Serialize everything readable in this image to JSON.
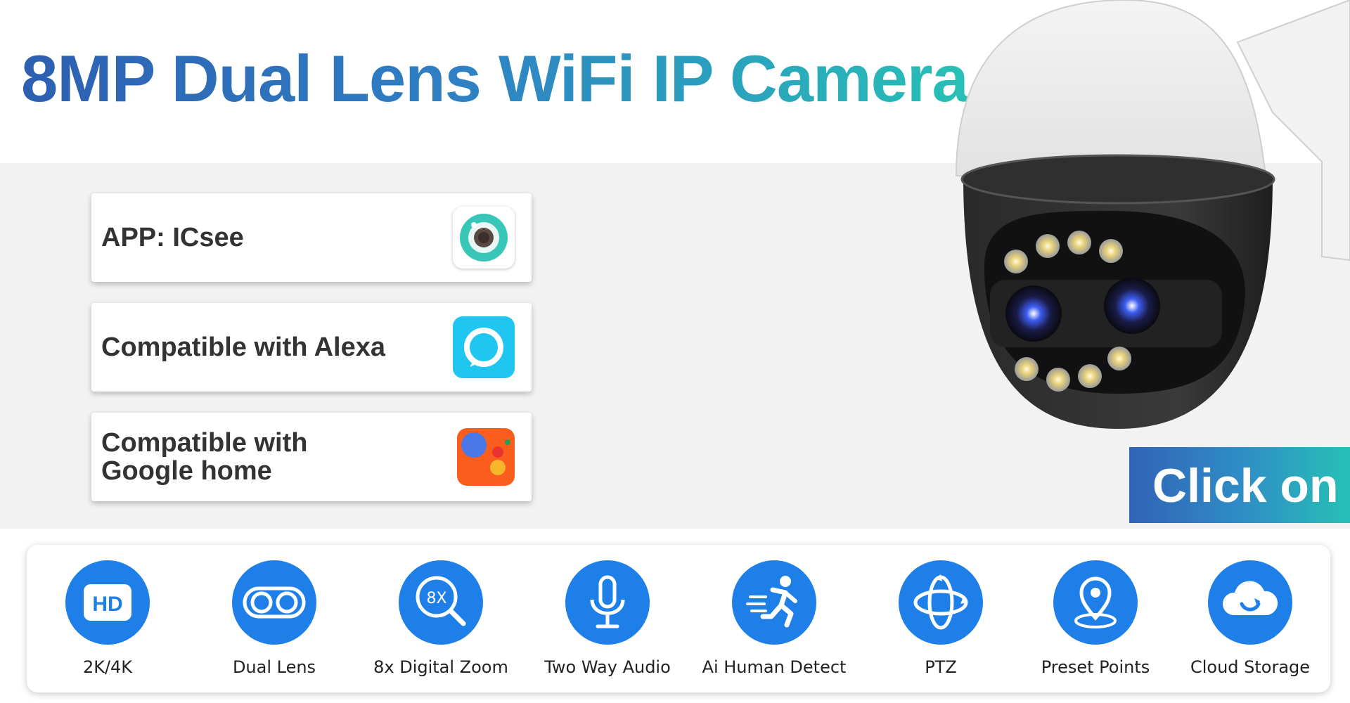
{
  "headline": "8MP Dual Lens WiFi IP Camera",
  "cards": [
    {
      "label": "APP: ICsee",
      "icon": "icsee-app-icon"
    },
    {
      "label": "Compatible with Alexa",
      "icon": "alexa-icon"
    },
    {
      "label": "Compatible with\nGoogle home",
      "icon": "google-home-icon"
    }
  ],
  "cta": {
    "label": "Click on"
  },
  "features": [
    {
      "label": "2K/4K",
      "icon": "hd-icon"
    },
    {
      "label": "Dual Lens",
      "icon": "dual-lens-icon"
    },
    {
      "label": "8x Digital Zoom",
      "icon": "zoom-icon"
    },
    {
      "label": "Two Way Audio",
      "icon": "microphone-icon"
    },
    {
      "label": "Ai Human Detect",
      "icon": "running-person-icon"
    },
    {
      "label": "PTZ",
      "icon": "rotate-icon"
    },
    {
      "label": "Preset Points",
      "icon": "location-pin-icon"
    },
    {
      "label": "Cloud Storage",
      "icon": "cloud-icon"
    }
  ],
  "icon_texts": {
    "hd": "HD",
    "zoom": "8X"
  },
  "colors": {
    "title_start": "#2d5fb0",
    "title_end": "#27c0b6",
    "feature_blue": "#1f7fe8",
    "alexa_cyan": "#1ec6f0",
    "card_text": "#333333"
  }
}
